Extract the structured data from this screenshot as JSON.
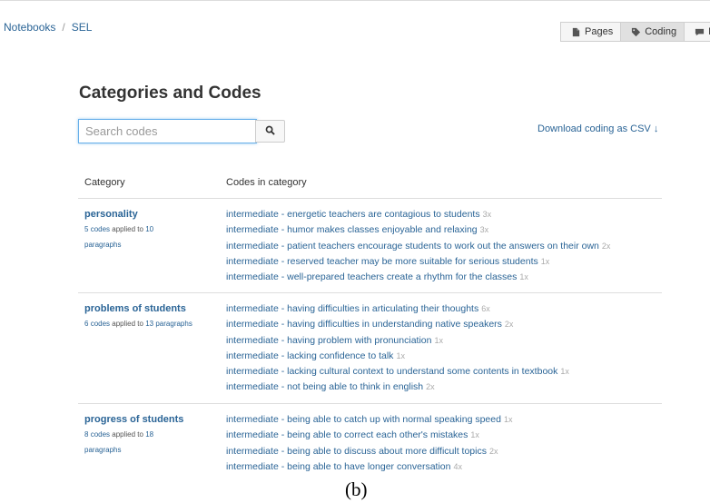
{
  "breadcrumb": {
    "root": "Notebooks",
    "separator": "/",
    "current": "SEL"
  },
  "view_tabs": [
    {
      "label": "Pages",
      "icon": "page-icon",
      "active": false
    },
    {
      "label": "Coding",
      "icon": "tag-icon",
      "active": true
    },
    {
      "label": "Me",
      "icon": "comment-icon",
      "active": false
    }
  ],
  "title": "Categories and Codes",
  "search": {
    "placeholder": "Search codes",
    "value": "",
    "button_icon": "search-icon"
  },
  "download": {
    "label": "Download coding as CSV",
    "arrow": "↓"
  },
  "table": {
    "header": {
      "category": "Category",
      "codes": "Codes in category"
    },
    "rows": [
      {
        "category": "personality",
        "codes_count": "5",
        "codes_word": "codes",
        "applied_text": "applied to",
        "paragraphs_count": "10",
        "paragraphs_word": "paragraphs",
        "codes": [
          {
            "text": "intermediate - energetic teachers are contagious to students",
            "count": "3x"
          },
          {
            "text": "intermediate - humor makes classes enjoyable and relaxing",
            "count": "3x"
          },
          {
            "text": "intermediate - patient teachers encourage students to work out the answers on their own",
            "count": "2x"
          },
          {
            "text": "intermediate - reserved teacher may be more suitable for serious students",
            "count": "1x"
          },
          {
            "text": "intermediate - well-prepared teachers create a rhythm for the classes",
            "count": "1x"
          }
        ]
      },
      {
        "category": "problems of students",
        "codes_count": "6",
        "codes_word": "codes",
        "applied_text": "applied to",
        "paragraphs_count": "13",
        "paragraphs_word": "paragraphs",
        "codes": [
          {
            "text": "intermediate - having difficulties in articulating their thoughts",
            "count": "6x"
          },
          {
            "text": "intermediate - having difficulties in understanding native speakers",
            "count": "2x"
          },
          {
            "text": "intermediate - having problem with pronunciation",
            "count": "1x"
          },
          {
            "text": "intermediate - lacking confidence to talk",
            "count": "1x"
          },
          {
            "text": "intermediate - lacking cultural context to understand some contents in textbook",
            "count": "1x"
          },
          {
            "text": "intermediate - not being able to think in english",
            "count": "2x"
          }
        ]
      },
      {
        "category": "progress of students",
        "codes_count": "8",
        "codes_word": "codes",
        "applied_text": "applied to",
        "paragraphs_count": "18",
        "paragraphs_word": "paragraphs",
        "codes": [
          {
            "text": "intermediate - being able to catch up with normal speaking speed",
            "count": "1x"
          },
          {
            "text": "intermediate - being able to correct each other's mistakes",
            "count": "1x"
          },
          {
            "text": "intermediate - being able to discuss about more difficult topics",
            "count": "2x"
          },
          {
            "text": "intermediate - being able to have longer conversation",
            "count": "4x"
          }
        ]
      }
    ]
  },
  "caption": "(b)"
}
